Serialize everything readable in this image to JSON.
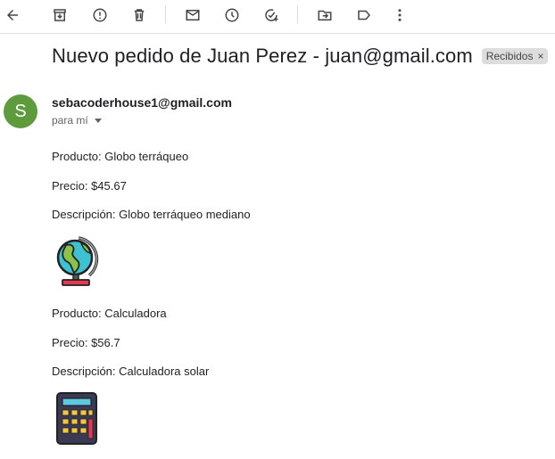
{
  "toolbar": {
    "icons": [
      "back-arrow-icon",
      "archive-icon",
      "report-spam-icon",
      "delete-icon",
      "mark-unread-icon",
      "snooze-icon",
      "add-to-tasks-icon",
      "move-to-icon",
      "label-icon",
      "more-options-icon"
    ]
  },
  "email": {
    "subject": "Nuevo pedido de Juan Perez - juan@gmail.com",
    "label": "Recibidos",
    "label_close": "×",
    "avatar_letter": "S",
    "avatar_color": "#5d9b3d",
    "sender": "sebacoderhouse1@gmail.com",
    "recipient": "para mí"
  },
  "products": [
    {
      "name_line": "Producto: Globo terráqueo",
      "price_line": "Precio: $45.67",
      "description_line": "Descripción: Globo terráqueo mediano",
      "image_icon": "globe-icon"
    },
    {
      "name_line": "Producto: Calculadora",
      "price_line": "Precio: $56.7",
      "description_line": "Descripción: Calculadora solar",
      "image_icon": "calculator-icon"
    }
  ]
}
